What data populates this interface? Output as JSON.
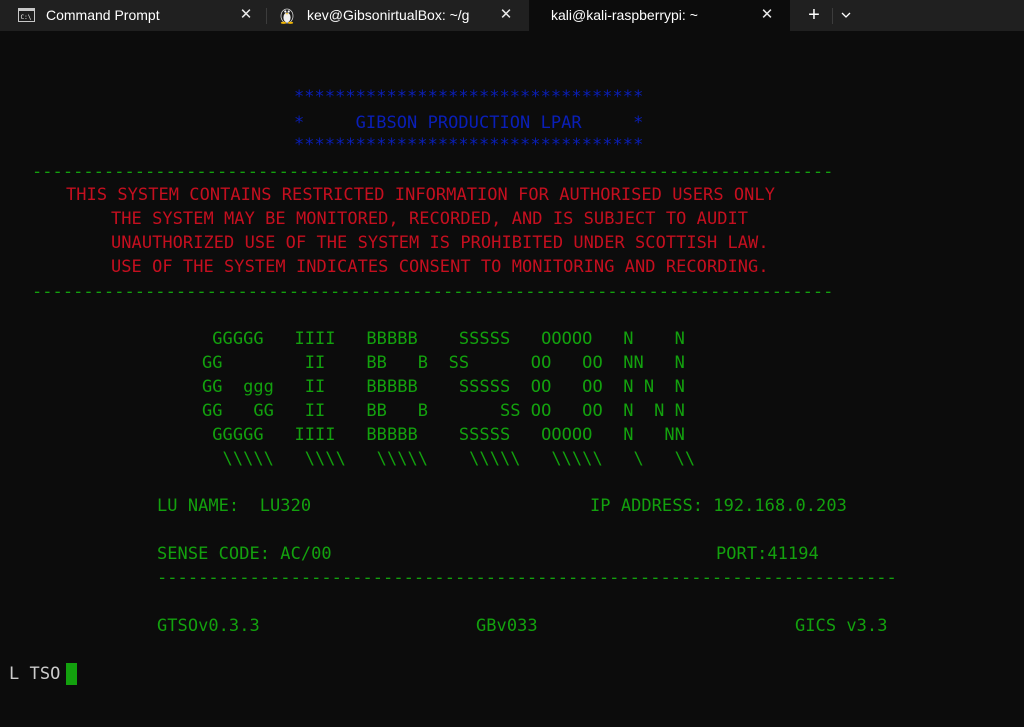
{
  "tabs": [
    {
      "title": "Command Prompt",
      "icon": "cmd-icon",
      "active": false
    },
    {
      "title": "kev@GibsonirtualBox: ~/g",
      "icon": "linux-tux-icon",
      "active": false
    },
    {
      "title": "kali@kali-raspberrypi: ~",
      "icon": "",
      "active": true
    }
  ],
  "tabbar": {
    "close_glyph": "✕",
    "new_tab_glyph": "+",
    "dropdown_glyph": "⌄"
  },
  "terminal": {
    "banner": {
      "stars_top": "**********************************",
      "title_line": "*     GIBSON PRODUCTION LPAR     *",
      "stars_bottom": "**********************************"
    },
    "divider": "------------------------------------------------------------------------------",
    "warning": [
      "THIS SYSTEM CONTAINS RESTRICTED INFORMATION FOR AUTHORISED USERS ONLY",
      "THE SYSTEM MAY BE MONITORED, RECORDED, AND IS SUBJECT TO AUDIT",
      "UNAUTHORIZED USE OF THE SYSTEM IS PROHIBITED UNDER SCOTTISH LAW.",
      "USE OF THE SYSTEM INDICATES CONSENT TO MONITORING AND RECORDING."
    ],
    "logo": [
      " GGGGG   IIII   BBBBB    SSSSS   OOOOO   N    N",
      "GG        II    BB   B  SS      OO   OO  NN   N",
      "GG  ggg   II    BBBBB    SSSSS  OO   OO  N N  N",
      "GG   GG   II    BB   B       SS OO   OO  N  N N",
      " GGGGG   IIII   BBBBB    SSSSS   OOOOO   N   NN",
      "  \\\\\\\\\\   \\\\\\\\   \\\\\\\\\\    \\\\\\\\\\   \\\\\\\\\\   \\   \\\\"
    ],
    "lu_name_line": "LU NAME:  LU320",
    "ip_line": "IP ADDRESS: 192.168.0.203",
    "sense_line": "SENSE CODE: AC/00",
    "port_line": "PORT:41194",
    "version_tso": "GTSOv0.3.3",
    "version_gb": "GBv033",
    "version_gics": "GICS v3.3",
    "command": "L TSO"
  },
  "colors": {
    "background": "#0c0c0c",
    "banner": "#0a1fb8",
    "green": "#13a10e",
    "red": "#c50f1f"
  }
}
